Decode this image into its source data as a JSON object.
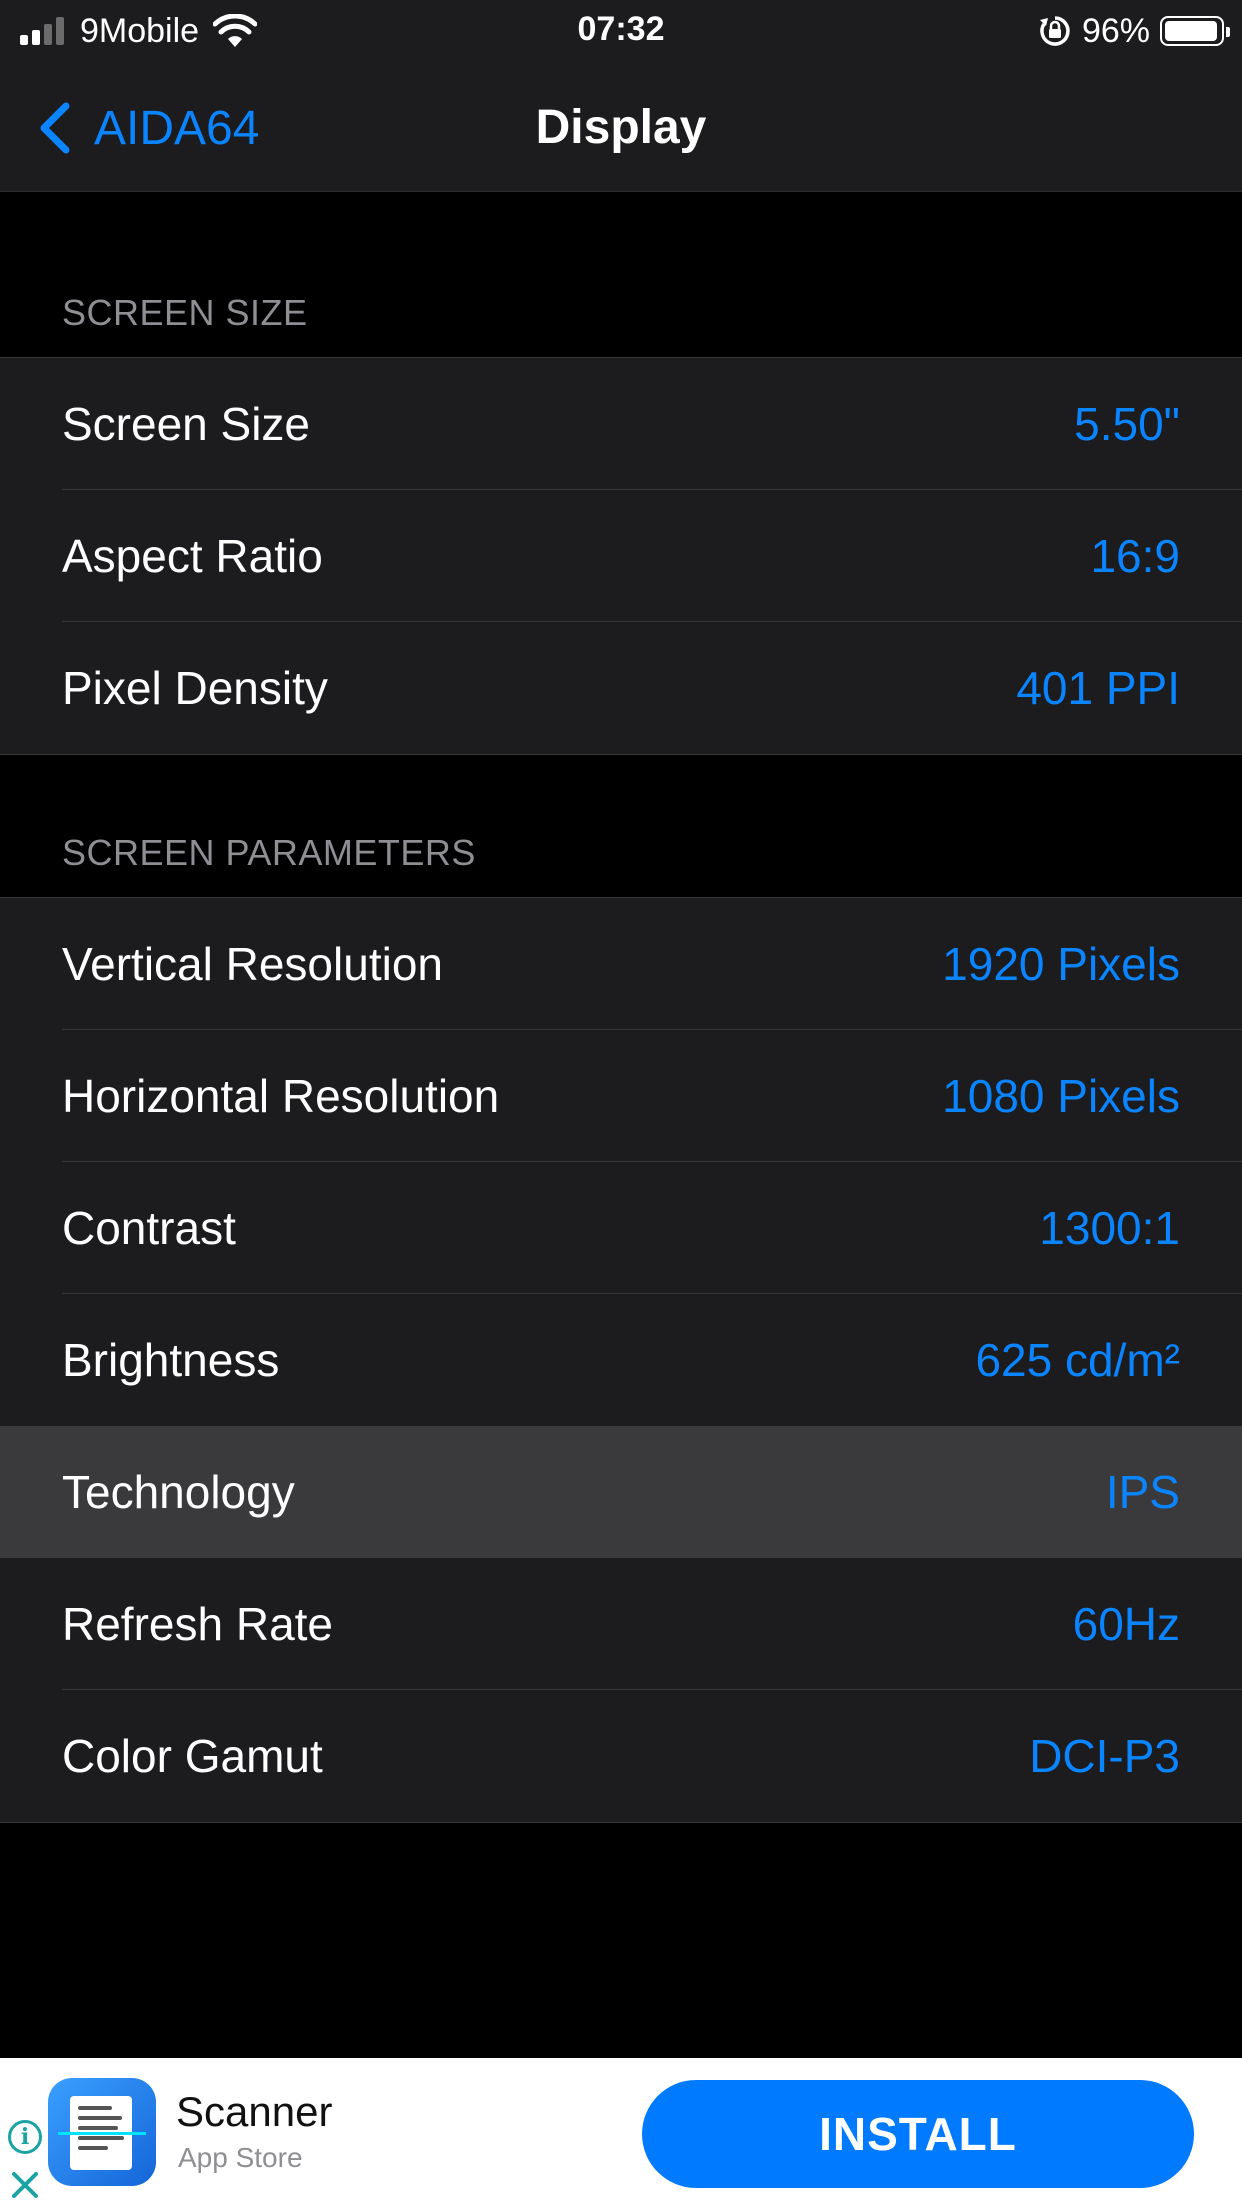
{
  "status_bar": {
    "carrier": "9Mobile",
    "time": "07:32",
    "battery_percent": "96%",
    "signal_bars": 4,
    "signal_bars_active": 2,
    "battery_level": 0.96
  },
  "nav": {
    "back_label": "AIDA64",
    "title": "Display"
  },
  "sections": [
    {
      "header": "SCREEN SIZE",
      "rows": [
        {
          "label": "Screen Size",
          "value": "5.50\""
        },
        {
          "label": "Aspect Ratio",
          "value": "16:9"
        },
        {
          "label": "Pixel Density",
          "value": "401 PPI"
        }
      ]
    },
    {
      "header": "SCREEN PARAMETERS",
      "rows": [
        {
          "label": "Vertical Resolution",
          "value": "1920 Pixels"
        },
        {
          "label": "Horizontal Resolution",
          "value": "1080 Pixels"
        },
        {
          "label": "Contrast",
          "value": "1300:1"
        },
        {
          "label": "Brightness",
          "value": "625 cd/m²"
        },
        {
          "label": "Technology",
          "value": "IPS",
          "highlighted": true
        },
        {
          "label": "Refresh Rate",
          "value": "60Hz"
        },
        {
          "label": "Color Gamut",
          "value": "DCI-P3"
        }
      ]
    }
  ],
  "ad": {
    "app_name": "Scanner",
    "store": "App Store",
    "button_label": "INSTALL",
    "info_icon": "info-icon",
    "close_icon": "close-icon"
  },
  "colors": {
    "accent": "#0a84ff",
    "background": "#000000",
    "cell_background": "#1c1c1e",
    "highlight_row": "#3a3a3c",
    "install_button": "#007aff"
  }
}
